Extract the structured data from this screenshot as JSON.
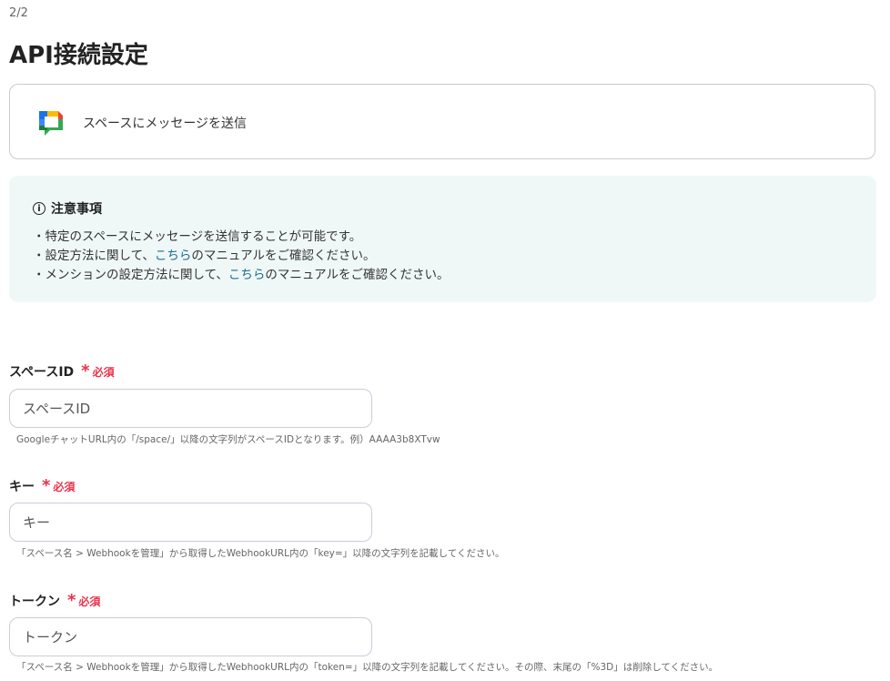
{
  "step": "2/2",
  "title": "API接続設定",
  "action": {
    "label": "スペースにメッセージを送信",
    "icon": "google-chat-icon"
  },
  "note": {
    "heading": "注意事項",
    "lines": [
      {
        "pre": "・特定のスペースにメッセージを送信することが可能です。"
      },
      {
        "pre": "・設定方法に関して、",
        "link": "こちら",
        "post": "のマニュアルをご確認ください。"
      },
      {
        "pre": "・メンションの設定方法に関して、",
        "link": "こちら",
        "post": "のマニュアルをご確認ください。"
      }
    ]
  },
  "required_label": "必須",
  "fields": [
    {
      "label": "スペースID",
      "placeholder": "スペースID",
      "value": "",
      "help": "GoogleチャットURL内の「/space/」以降の文字列がスペースIDとなります。例）AAAA3b8XTvw"
    },
    {
      "label": "キー",
      "placeholder": "キー",
      "value": "",
      "help": "「スペース名 > Webhookを管理」から取得したWebhookURL内の「key=」以降の文字列を記載してください。"
    },
    {
      "label": "トークン",
      "placeholder": "トークン",
      "value": "",
      "help": "「スペース名 > Webhookを管理」から取得したWebhookURL内の「token=」以降の文字列を記載してください。その際、末尾の「%3D」は削除してください。"
    }
  ],
  "colors": {
    "accent_link": "#1a6e8e",
    "required": "#e8334a",
    "note_bg": "#f0f8f7"
  }
}
